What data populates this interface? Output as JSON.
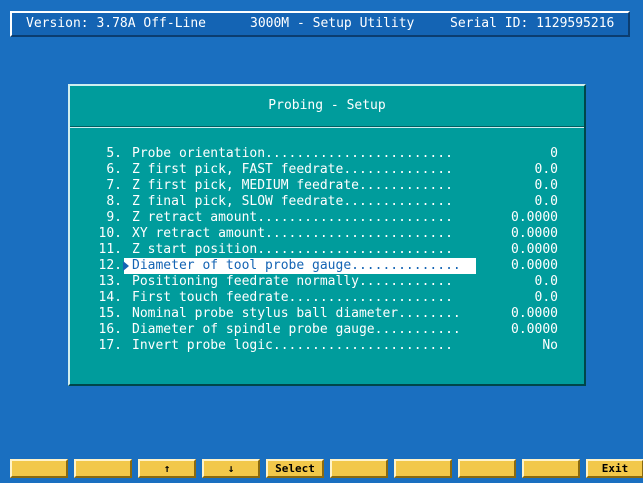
{
  "header": {
    "version": "Version: 3.78A Off-Line",
    "title": "3000M - Setup Utility",
    "serial": "Serial ID: 1129595216"
  },
  "panel": {
    "title": "Probing - Setup",
    "items": [
      {
        "num": "5.",
        "label": "Probe orientation........................",
        "value": "0"
      },
      {
        "num": "6.",
        "label": "Z first pick, FAST feedrate..............",
        "value": "0.0"
      },
      {
        "num": "7.",
        "label": "Z first pick, MEDIUM feedrate............",
        "value": "0.0"
      },
      {
        "num": "8.",
        "label": "Z final pick, SLOW feedrate..............",
        "value": "0.0"
      },
      {
        "num": "9.",
        "label": "Z retract amount.........................",
        "value": "0.0000"
      },
      {
        "num": "10.",
        "label": "XY retract amount........................",
        "value": "0.0000"
      },
      {
        "num": "11.",
        "label": "Z start position.........................",
        "value": "0.0000"
      },
      {
        "num": "12.",
        "label": "Diameter of tool probe gauge..............",
        "value": "0.0000"
      },
      {
        "num": "13.",
        "label": "Positioning feedrate normally............",
        "value": "0.0"
      },
      {
        "num": "14.",
        "label": "First touch feedrate.....................",
        "value": "0.0"
      },
      {
        "num": "15.",
        "label": "Nominal probe stylus ball diameter........",
        "value": "0.0000"
      },
      {
        "num": "16.",
        "label": "Diameter of spindle probe gauge...........",
        "value": "0.0000"
      },
      {
        "num": "17.",
        "label": "Invert probe logic.......................",
        "value": "No"
      }
    ],
    "selected_index": 7
  },
  "function_keys": [
    "",
    "",
    "↑",
    "↓",
    "Select",
    "",
    "",
    "",
    "",
    "Exit"
  ],
  "colors": {
    "background": "#1a6fc0",
    "panel": "#009c9c",
    "highlight": "#ffffff",
    "function_key": "#f2c84a"
  }
}
